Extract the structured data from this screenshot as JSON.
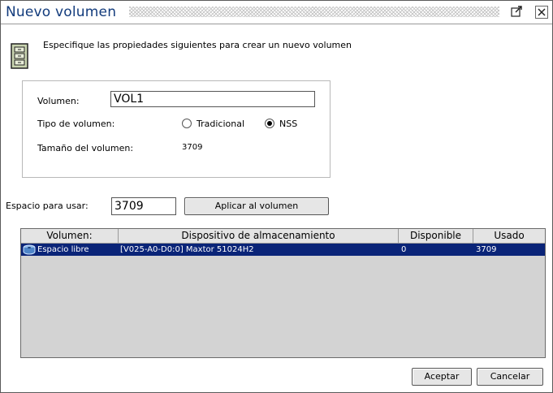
{
  "window": {
    "title": "Nuevo volumen",
    "maximize_icon": "maximize-icon",
    "close_icon": "close-icon"
  },
  "header": {
    "icon": "cabinet-icon",
    "instruction": "Especifique las propiedades siguientes para crear un nuevo volumen"
  },
  "properties": {
    "volume_label": "Volumen:",
    "volume_value": "VOL1",
    "type_label": "Tipo de volumen:",
    "type_options": [
      {
        "label": "Tradicional",
        "selected": false
      },
      {
        "label": "NSS",
        "selected": true
      }
    ],
    "size_label": "Tamaño del volumen:",
    "size_value": "3709"
  },
  "space": {
    "label": "Espacio para usar:",
    "value": "3709",
    "apply_button": "Aplicar al volumen"
  },
  "table": {
    "columns": [
      "Volumen:",
      "Dispositivo de almacenamiento",
      "Disponible",
      "Usado"
    ],
    "rows": [
      {
        "icon": "disk-icon",
        "volume": "Espacio libre",
        "device": "[V025-A0-D0:0] Maxtor 51024H2",
        "available": "0",
        "used": "3709",
        "selected": true
      }
    ]
  },
  "footer": {
    "ok_button": "Aceptar",
    "cancel_button": "Cancelar"
  },
  "colors": {
    "title": "#123b7c",
    "selection": "#0a2478",
    "table_bg": "#d3d3d3"
  }
}
